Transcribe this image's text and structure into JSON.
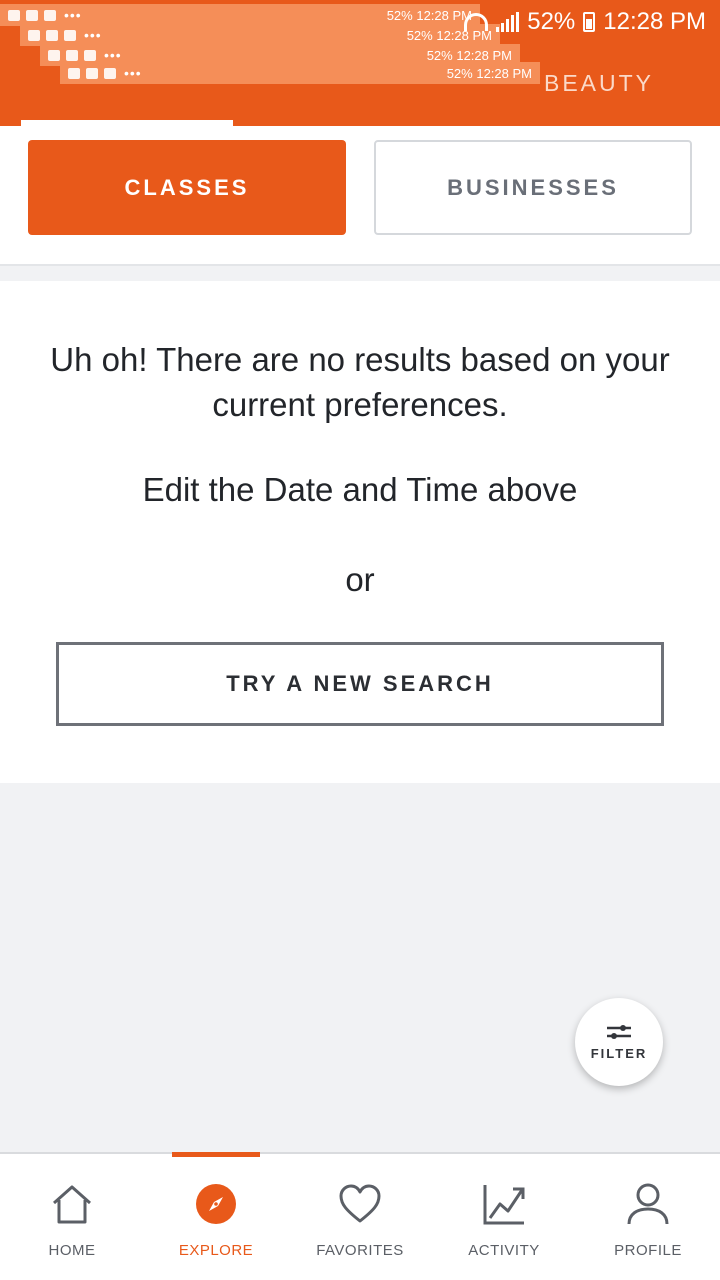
{
  "status_bar": {
    "battery": "52%",
    "time": "12:28 PM"
  },
  "notifications": [
    {
      "battery": "52%",
      "time": "12:28 PM",
      "dots": "•••"
    },
    {
      "battery": "52%",
      "time": "12:28 PM",
      "dots": "•••"
    },
    {
      "battery": "52%",
      "time": "12:28 PM",
      "dots": "•••"
    },
    {
      "battery": "52%",
      "time": "12:28 PM",
      "dots": "•••"
    }
  ],
  "category_tabs": {
    "visible": "BEAUTY"
  },
  "toggle": {
    "classes": "CLASSES",
    "businesses": "BUSINESSES"
  },
  "empty_state": {
    "message": "Uh oh! There are no results based on your current preferences.",
    "hint": "Edit the Date and Time above",
    "or": "or",
    "button": "TRY A NEW SEARCH"
  },
  "fab": {
    "label": "FILTER"
  },
  "bottom_nav": [
    {
      "label": "HOME",
      "icon": "home-icon"
    },
    {
      "label": "EXPLORE",
      "icon": "compass-icon",
      "active": true
    },
    {
      "label": "FAVORITES",
      "icon": "heart-icon"
    },
    {
      "label": "ACTIVITY",
      "icon": "chart-icon"
    },
    {
      "label": "PROFILE",
      "icon": "person-icon"
    }
  ],
  "colors": {
    "brand": "#e8591a",
    "background": "#f1f2f4",
    "text": "#22252a"
  }
}
